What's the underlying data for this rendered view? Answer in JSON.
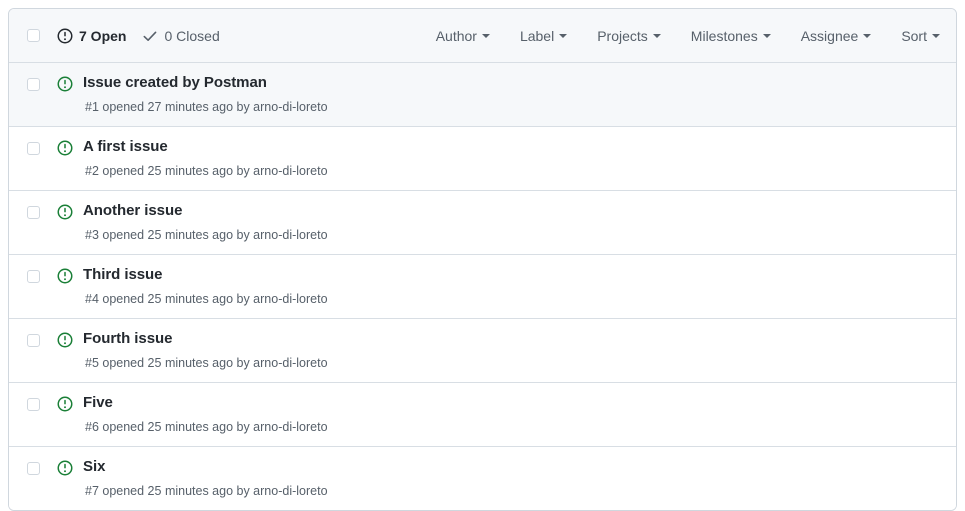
{
  "header": {
    "select_all_checkbox": "select-all",
    "open_count_label": "7 Open",
    "closed_count_label": "0 Closed",
    "open_icon": "issue-opened-icon",
    "closed_icon": "check-icon",
    "filters": [
      {
        "label": "Author"
      },
      {
        "label": "Label"
      },
      {
        "label": "Projects"
      },
      {
        "label": "Milestones"
      },
      {
        "label": "Assignee"
      },
      {
        "label": "Sort"
      }
    ]
  },
  "issues": [
    {
      "title": "Issue created by Postman",
      "meta": "#1 opened 27 minutes ago by arno-di-loreto",
      "number": "#1",
      "state_icon": "issue-opened-icon",
      "highlighted": true
    },
    {
      "title": "A first issue",
      "meta": "#2 opened 25 minutes ago by arno-di-loreto",
      "number": "#2",
      "state_icon": "issue-opened-icon",
      "highlighted": false
    },
    {
      "title": "Another issue",
      "meta": "#3 opened 25 minutes ago by arno-di-loreto",
      "number": "#3",
      "state_icon": "issue-opened-icon",
      "highlighted": false
    },
    {
      "title": "Third issue",
      "meta": "#4 opened 25 minutes ago by arno-di-loreto",
      "number": "#4",
      "state_icon": "issue-opened-icon",
      "highlighted": false
    },
    {
      "title": "Fourth issue",
      "meta": "#5 opened 25 minutes ago by arno-di-loreto",
      "number": "#5",
      "state_icon": "issue-opened-icon",
      "highlighted": false
    },
    {
      "title": "Five",
      "meta": "#6 opened 25 minutes ago by arno-di-loreto",
      "number": "#6",
      "state_icon": "issue-opened-icon",
      "highlighted": false
    },
    {
      "title": "Six",
      "meta": "#7 opened 25 minutes ago by arno-di-loreto",
      "number": "#7",
      "state_icon": "issue-opened-icon",
      "highlighted": false
    }
  ],
  "colors": {
    "open_issue_green": "#1a7f37",
    "text_primary": "#24292f",
    "text_muted": "#57606a",
    "border": "#d0d7de",
    "row_highlight_bg": "#f6f8fa"
  }
}
